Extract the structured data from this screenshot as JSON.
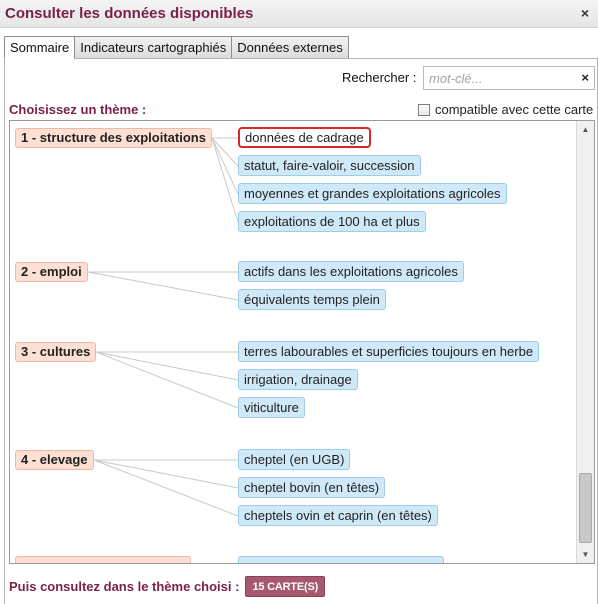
{
  "window": {
    "title": "Consulter les données disponibles",
    "close_glyph": "×"
  },
  "tabs": [
    {
      "label": "Sommaire",
      "active": true
    },
    {
      "label": "Indicateurs cartographiés",
      "active": false
    },
    {
      "label": "Données externes",
      "active": false
    }
  ],
  "search": {
    "label": "Rechercher :",
    "placeholder": "mot-clé...",
    "value": "",
    "clear_glyph": "×"
  },
  "choose_label": "Choisissez un thème :",
  "compat": {
    "label": "compatible avec cette carte",
    "checked": false
  },
  "themes": [
    {
      "label": "1 - structure des exploitations",
      "subs": [
        "données de cadrage",
        "statut, faire-valoir, succession",
        "moyennes et grandes exploitations agricoles",
        "exploitations de 100 ha et plus"
      ]
    },
    {
      "label": "2 - emploi",
      "subs": [
        "actifs dans les exploitations agricoles",
        "équivalents temps plein"
      ]
    },
    {
      "label": "3 - cultures",
      "subs": [
        "terres labourables et superficies toujours en herbe",
        "irrigation, drainage",
        "viticulture"
      ]
    },
    {
      "label": "4 - elevage",
      "subs": [
        "cheptel (en UGB)",
        "cheptel bovin (en têtes)",
        "cheptels ovin et caprin (en têtes)"
      ]
    }
  ],
  "selected_sub": "données de cadrage",
  "footer": {
    "label": "Puis consultez dans le thème choisi :",
    "button_label": "15 CARTE(S)"
  },
  "colors": {
    "accent": "#7a1f4a",
    "theme_bg": "#fde0d3",
    "sub_bg": "#cfe9f8",
    "selected_border": "#d62a2a",
    "button_bg": "#a6586e"
  }
}
